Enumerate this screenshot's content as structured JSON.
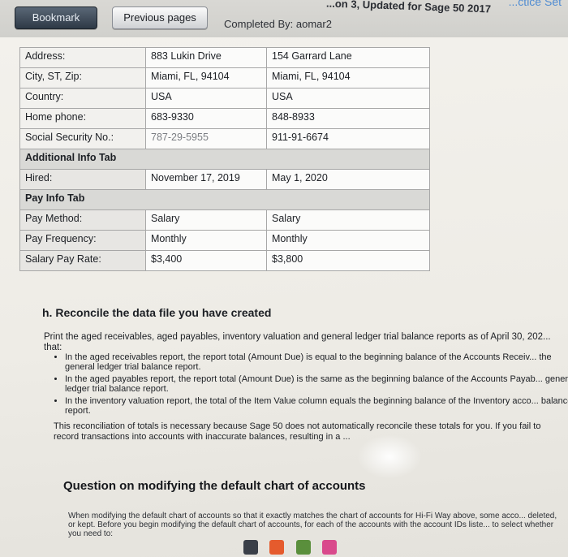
{
  "header": {
    "title": "...on 3, Updated for Sage 50 2017",
    "practice": "...ctice Set",
    "tabs": {
      "bookmark": "Bookmark",
      "previous": "Previous pages"
    },
    "completed_by": "Completed By: aomar2"
  },
  "table": {
    "rows": [
      {
        "label": "Address:",
        "v1": "883 Lukin Drive",
        "v2": "154 Garrard Lane"
      },
      {
        "label": "City, ST, Zip:",
        "v1": "Miami, FL, 94104",
        "v2": "Miami, FL, 94104"
      },
      {
        "label": "Country:",
        "v1": "USA",
        "v2": "USA"
      },
      {
        "label": "Home phone:",
        "v1": "683-9330",
        "v2": "848-8933"
      },
      {
        "label": "Social Security No.:",
        "v1": "787-29-5955",
        "v2": "911-91-6674"
      }
    ],
    "section_additional": "Additional Info Tab",
    "hired": {
      "label": "Hired:",
      "v1": "November 17, 2019",
      "v2": "May 1, 2020"
    },
    "section_pay": "Pay Info Tab",
    "pay_rows": [
      {
        "label": "Pay Method:",
        "v1": "Salary",
        "v2": "Salary"
      },
      {
        "label": "Pay Frequency:",
        "v1": "Monthly",
        "v2": "Monthly"
      },
      {
        "label": "Salary Pay Rate:",
        "v1": "$3,400",
        "v2": "$3,800"
      }
    ]
  },
  "reconcile": {
    "heading": "h. Reconcile the data file you have created",
    "intro": "Print the aged receivables, aged payables, inventory valuation and general ledger trial balance reports as of April 30, 202... that:",
    "bullets": [
      "In the aged receivables report, the report total (Amount Due) is equal to the beginning balance of the Accounts Receiv... the general ledger trial balance report.",
      "In the aged payables report, the report total (Amount Due) is the same as the beginning balance of the Accounts Payab... general ledger trial balance report.",
      "In the inventory valuation report, the total of the Item Value column equals the beginning balance of the Inventory acco... balance report."
    ],
    "note": "This reconciliation of totals is necessary because Sage 50 does not automatically reconcile these totals for you. If you fail to record transactions into accounts with inaccurate balances, resulting in a ..."
  },
  "question": {
    "heading": "Question on modifying the default chart of accounts",
    "text": "When modifying the default chart of accounts so that it exactly matches the chart of accounts for Hi-Fi Way above, some acco... deleted, or kept. Before you begin modifying the default chart of accounts, for each of the accounts with the account IDs liste... to select whether you need to:"
  },
  "colors": {
    "tab_dark": "#2e3946",
    "accent_link": "#4f8bd1"
  }
}
